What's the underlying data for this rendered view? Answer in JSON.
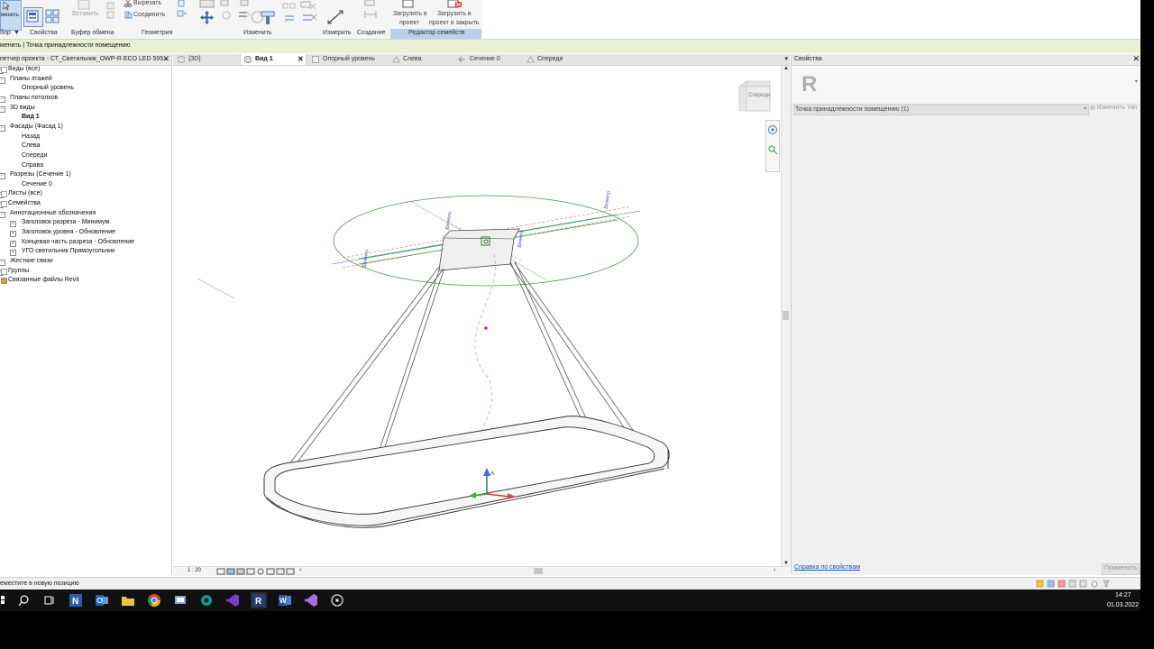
{
  "ribbon": {
    "modify_label": "менить",
    "cut_label": "Вырезать",
    "join_label": "Соединить",
    "paste_label": "Вставить",
    "load_into_project_label": "Загрузить в проект",
    "load_into_project_line1": "Загрузить в",
    "load_into_project_line2": "проект",
    "load_and_close_line1": "Загрузить в",
    "load_and_close_line2": "проект и закрыть",
    "groups": {
      "select": "бор",
      "properties": "Свойства",
      "clipboard": "Буфер обмена",
      "geometry": "Геометрия",
      "modify": "Изменить",
      "measure": "Измерить",
      "create": "Создание",
      "family_editor": "Редактор семейств"
    }
  },
  "context_bar": {
    "text": "менить | Точка принадлежности помещению"
  },
  "project_browser": {
    "title": "петчер проекта - СТ_Светильник_OWP-R ECO LED 595...",
    "items": [
      {
        "label": "Виды (все)",
        "indent": 0,
        "bold": false
      },
      {
        "label": "Планы этажей",
        "indent": 1,
        "bold": false
      },
      {
        "label": "Опорный уровень",
        "indent": 2,
        "bold": false
      },
      {
        "label": "Планы потолков",
        "indent": 1,
        "bold": false
      },
      {
        "label": "3D виды",
        "indent": 1,
        "bold": false
      },
      {
        "label": "Вид 1",
        "indent": 2,
        "bold": true
      },
      {
        "label": "Фасады (Фасад 1)",
        "indent": 1,
        "bold": false
      },
      {
        "label": "Назад",
        "indent": 2,
        "bold": false
      },
      {
        "label": "Слева",
        "indent": 2,
        "bold": false
      },
      {
        "label": "Спереди",
        "indent": 2,
        "bold": false
      },
      {
        "label": "Справа",
        "indent": 2,
        "bold": false
      },
      {
        "label": "Разрезы (Сечение 1)",
        "indent": 1,
        "bold": false
      },
      {
        "label": "Сечение 0",
        "indent": 2,
        "bold": false
      },
      {
        "label": "Листы (все)",
        "indent": 0,
        "bold": false
      },
      {
        "label": "Семейства",
        "indent": 0,
        "bold": false
      },
      {
        "label": "Аннотационные обозначения",
        "indent": 1,
        "bold": false
      },
      {
        "label": "Заголовок разреза - Минимум",
        "indent": 2,
        "bold": false
      },
      {
        "label": "Заголовок уровня - Обновление",
        "indent": 2,
        "bold": false
      },
      {
        "label": "Концевая часть разреза - Обновление",
        "indent": 2,
        "bold": false
      },
      {
        "label": "УГО светильник Прямоугольник",
        "indent": 2,
        "bold": false
      },
      {
        "label": "Жесткие связи",
        "indent": 1,
        "bold": false
      },
      {
        "label": "Группы",
        "indent": 0,
        "bold": false
      },
      {
        "label": "Связанные файлы Revit",
        "indent": 0,
        "bold": false
      }
    ]
  },
  "view_tabs": [
    {
      "label": "{3D}",
      "active": false
    },
    {
      "label": "Вид 1",
      "active": true
    },
    {
      "label": "Опорный уровень",
      "active": false
    },
    {
      "label": "Слева",
      "active": false
    },
    {
      "label": "Сечение 0",
      "active": false
    },
    {
      "label": "Спереди",
      "active": false
    }
  ],
  "viewcube": {
    "face_label": "Спереди",
    "side_label": "Слева"
  },
  "model_labels": {
    "dimension": "Диаметр"
  },
  "view_control_bar": {
    "scale": "1 : 20"
  },
  "properties": {
    "title": "Свойства",
    "type_selector": "Точка принадлежности помещению (1)",
    "edit_type": "Изменить тип",
    "help_link": "Справка по свойствам",
    "apply": "Применить"
  },
  "status_bar": {
    "text": "еместите в новую позицию"
  },
  "taskbar": {
    "time": "14:27",
    "date": "01.03.2022",
    "apps": [
      "start-icon",
      "search-icon",
      "task-view-icon",
      "onenote-icon",
      "outlook-icon",
      "explorer-icon",
      "chrome-icon",
      "remote-icon",
      "gitkraken-icon",
      "visual-studio-icon",
      "revit-icon",
      "word-icon",
      "vs-purple-icon",
      "app-icon"
    ]
  },
  "colors": {
    "context_bar": "#e8f1d8",
    "family_editor_tab": "#bcd0ec",
    "reference_plane": "#4a9a4a",
    "dimension_text": "#3b50b3"
  }
}
